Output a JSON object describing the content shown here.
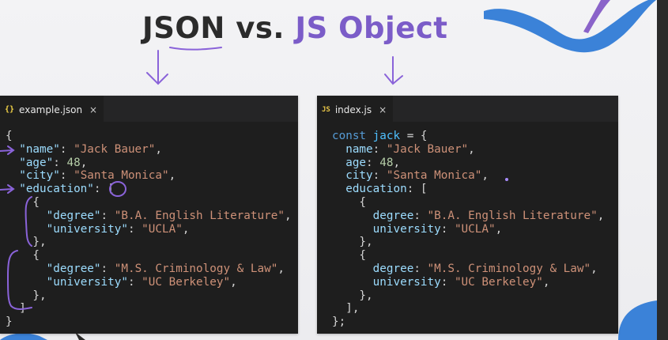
{
  "title": {
    "part1": "JSON",
    "part2": " vs. ",
    "part3": "JS Object"
  },
  "colors": {
    "accent_purple": "#7b5cc8",
    "editor_bg": "#1e1e1e",
    "key": "#9cdcfe",
    "string": "#ce9178",
    "number": "#b5cea8",
    "keyword": "#569cd6"
  },
  "left_editor": {
    "tab": {
      "icon": "{}",
      "icon_name": "json-file-icon",
      "label": "example.json",
      "close": "×"
    },
    "lines": [
      [
        {
          "t": "p",
          "v": "{"
        }
      ],
      [
        {
          "t": "p",
          "v": "  "
        },
        {
          "t": "k",
          "v": "\"name\""
        },
        {
          "t": "p",
          "v": ": "
        },
        {
          "t": "s",
          "v": "\"Jack Bauer\""
        },
        {
          "t": "p",
          "v": ","
        }
      ],
      [
        {
          "t": "p",
          "v": "  "
        },
        {
          "t": "k",
          "v": "\"age\""
        },
        {
          "t": "p",
          "v": ": "
        },
        {
          "t": "n",
          "v": "48"
        },
        {
          "t": "p",
          "v": ","
        }
      ],
      [
        {
          "t": "p",
          "v": "  "
        },
        {
          "t": "k",
          "v": "\"city\""
        },
        {
          "t": "p",
          "v": ": "
        },
        {
          "t": "s",
          "v": "\"Santa Monica\""
        },
        {
          "t": "p",
          "v": ","
        }
      ],
      [
        {
          "t": "p",
          "v": "  "
        },
        {
          "t": "k",
          "v": "\"education\""
        },
        {
          "t": "p",
          "v": ": ["
        }
      ],
      [
        {
          "t": "p",
          "v": "    {"
        }
      ],
      [
        {
          "t": "p",
          "v": "      "
        },
        {
          "t": "k",
          "v": "\"degree\""
        },
        {
          "t": "p",
          "v": ": "
        },
        {
          "t": "s",
          "v": "\"B.A. English Literature\""
        },
        {
          "t": "p",
          "v": ","
        }
      ],
      [
        {
          "t": "p",
          "v": "      "
        },
        {
          "t": "k",
          "v": "\"university\""
        },
        {
          "t": "p",
          "v": ": "
        },
        {
          "t": "s",
          "v": "\"UCLA\""
        },
        {
          "t": "p",
          "v": ","
        }
      ],
      [
        {
          "t": "p",
          "v": "    },"
        }
      ],
      [
        {
          "t": "p",
          "v": "    {"
        }
      ],
      [
        {
          "t": "p",
          "v": "      "
        },
        {
          "t": "k",
          "v": "\"degree\""
        },
        {
          "t": "p",
          "v": ": "
        },
        {
          "t": "s",
          "v": "\"M.S. Criminology & Law\""
        },
        {
          "t": "p",
          "v": ","
        }
      ],
      [
        {
          "t": "p",
          "v": "      "
        },
        {
          "t": "k",
          "v": "\"university\""
        },
        {
          "t": "p",
          "v": ": "
        },
        {
          "t": "s",
          "v": "\"UC Berkeley\""
        },
        {
          "t": "p",
          "v": ","
        }
      ],
      [
        {
          "t": "p",
          "v": "    },"
        }
      ],
      [
        {
          "t": "p",
          "v": "  ]"
        }
      ],
      [
        {
          "t": "p",
          "v": "}"
        }
      ]
    ]
  },
  "right_editor": {
    "tab": {
      "icon": "JS",
      "icon_name": "js-file-icon",
      "label": "index.js",
      "close": "×"
    },
    "lines": [
      [
        {
          "t": "kw",
          "v": "const"
        },
        {
          "t": "p",
          "v": " "
        },
        {
          "t": "v",
          "v": "jack"
        },
        {
          "t": "p",
          "v": " = {"
        }
      ],
      [
        {
          "t": "p",
          "v": "  "
        },
        {
          "t": "k",
          "v": "name"
        },
        {
          "t": "p",
          "v": ": "
        },
        {
          "t": "s",
          "v": "\"Jack Bauer\""
        },
        {
          "t": "p",
          "v": ","
        }
      ],
      [
        {
          "t": "p",
          "v": "  "
        },
        {
          "t": "k",
          "v": "age"
        },
        {
          "t": "p",
          "v": ": "
        },
        {
          "t": "n",
          "v": "48"
        },
        {
          "t": "p",
          "v": ","
        }
      ],
      [
        {
          "t": "p",
          "v": "  "
        },
        {
          "t": "k",
          "v": "city"
        },
        {
          "t": "p",
          "v": ": "
        },
        {
          "t": "s",
          "v": "\"Santa Monica\""
        },
        {
          "t": "p",
          "v": ","
        }
      ],
      [
        {
          "t": "p",
          "v": "  "
        },
        {
          "t": "k",
          "v": "education"
        },
        {
          "t": "p",
          "v": ": ["
        }
      ],
      [
        {
          "t": "p",
          "v": "    {"
        }
      ],
      [
        {
          "t": "p",
          "v": "      "
        },
        {
          "t": "k",
          "v": "degree"
        },
        {
          "t": "p",
          "v": ": "
        },
        {
          "t": "s",
          "v": "\"B.A. English Literature\""
        },
        {
          "t": "p",
          "v": ","
        }
      ],
      [
        {
          "t": "p",
          "v": "      "
        },
        {
          "t": "k",
          "v": "university"
        },
        {
          "t": "p",
          "v": ": "
        },
        {
          "t": "s",
          "v": "\"UCLA\""
        },
        {
          "t": "p",
          "v": ","
        }
      ],
      [
        {
          "t": "p",
          "v": "    },"
        }
      ],
      [
        {
          "t": "p",
          "v": "    {"
        }
      ],
      [
        {
          "t": "p",
          "v": "      "
        },
        {
          "t": "k",
          "v": "degree"
        },
        {
          "t": "p",
          "v": ": "
        },
        {
          "t": "s",
          "v": "\"M.S. Criminology & Law\""
        },
        {
          "t": "p",
          "v": ","
        }
      ],
      [
        {
          "t": "p",
          "v": "      "
        },
        {
          "t": "k",
          "v": "university"
        },
        {
          "t": "p",
          "v": ": "
        },
        {
          "t": "s",
          "v": "\"UC Berkeley\""
        },
        {
          "t": "p",
          "v": ","
        }
      ],
      [
        {
          "t": "p",
          "v": "    },"
        }
      ],
      [
        {
          "t": "p",
          "v": "  ],"
        }
      ],
      [
        {
          "t": "p",
          "v": "};"
        }
      ]
    ]
  }
}
